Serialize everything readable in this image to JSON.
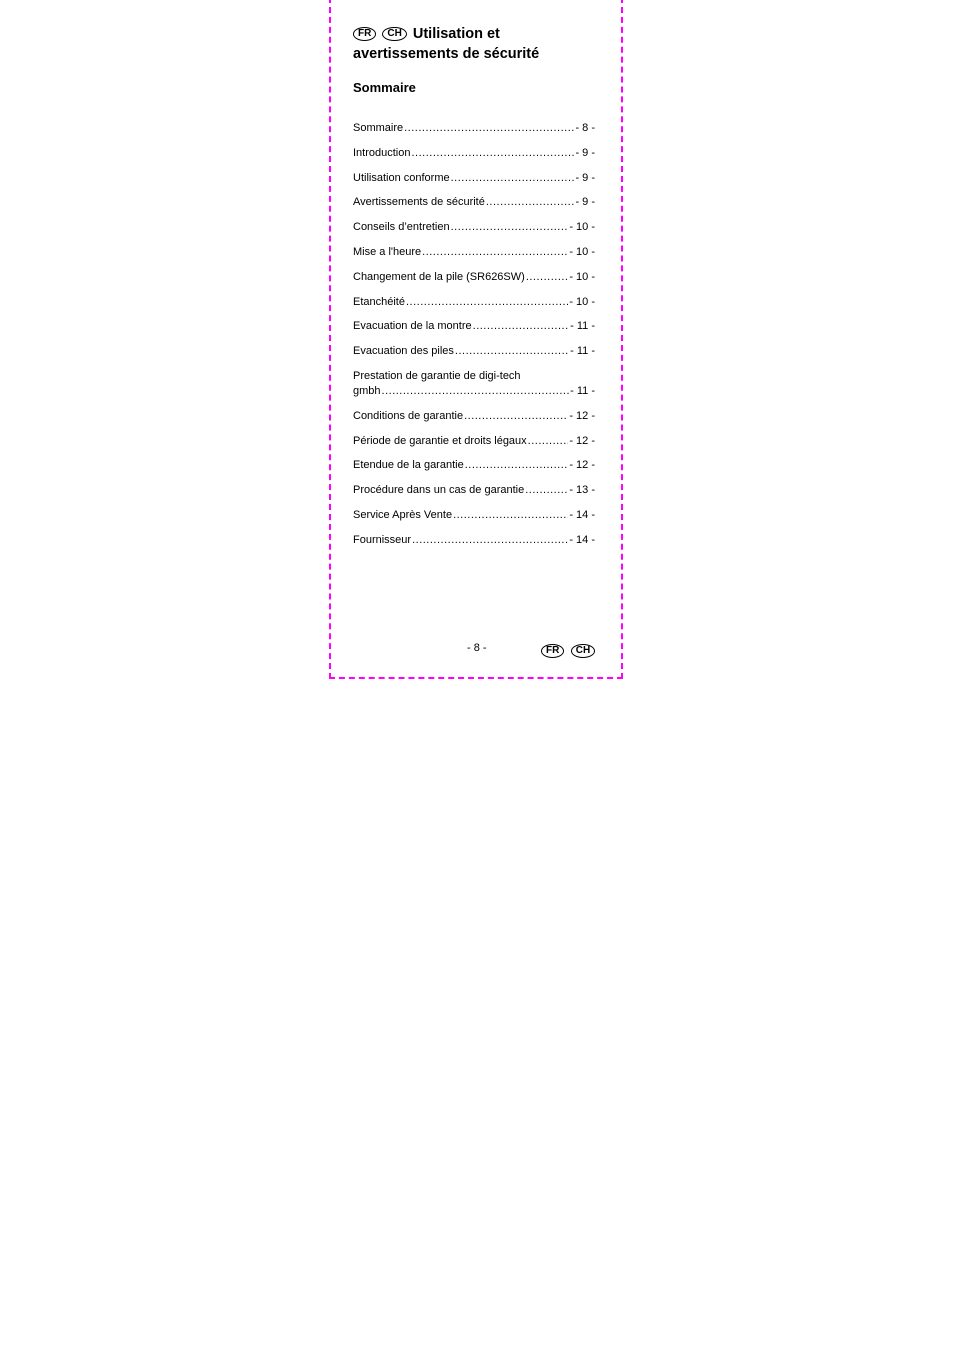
{
  "header": {
    "badges": [
      "FR",
      "CH"
    ],
    "title": "Utilisation et avertissements de sécurité"
  },
  "toc": {
    "heading": "Sommaire",
    "entries": [
      {
        "title": "Sommaire",
        "page": "- 8 -"
      },
      {
        "title": "Introduction",
        "page": "- 9 -"
      },
      {
        "title": "Utilisation conforme",
        "page": "- 9 -"
      },
      {
        "title": "Avertissements de sécurité",
        "page": "- 9 -"
      },
      {
        "title": "Conseils d’entretien",
        "page": "- 10 -"
      },
      {
        "title": "Mise a l'heure",
        "page": "- 10 -"
      },
      {
        "title": "Changement de la pile (SR626SW)",
        "page": "- 10 -"
      },
      {
        "title": "Etanchéité",
        "page": "- 10 -"
      },
      {
        "title": "Evacuation de la montre",
        "page": "- 11 -"
      },
      {
        "title": "Evacuation des piles",
        "page": "- 11 -"
      },
      {
        "title_line1": "Prestation de garantie de digi-tech",
        "title": "gmbh",
        "page": "- 11 -"
      },
      {
        "title": "Conditions de garantie",
        "page": "- 12 -"
      },
      {
        "title": "Période de garantie et droits légaux",
        "page": "- 12 -"
      },
      {
        "title": "Etendue de la garantie",
        "page": "- 12 -"
      },
      {
        "title": "Procédure dans un cas de garantie",
        "page": "- 13 -"
      },
      {
        "title": "Service Après Vente",
        "page": "- 14 -"
      },
      {
        "title": "Fournisseur",
        "page": "- 14 -"
      }
    ]
  },
  "footer": {
    "page_number": "- 8 -",
    "badges": [
      "FR",
      "CH"
    ]
  }
}
